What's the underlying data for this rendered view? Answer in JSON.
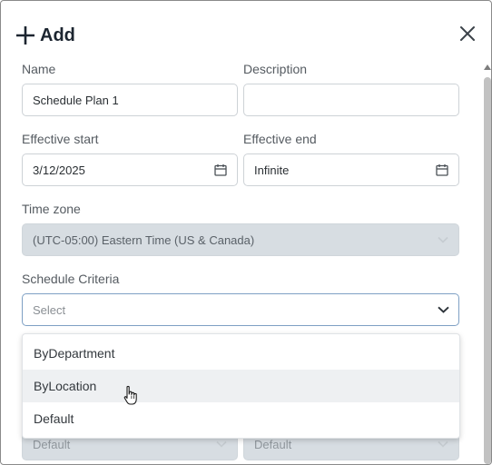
{
  "dialog": {
    "title": "Add",
    "fields": {
      "name": {
        "label": "Name",
        "value": "Schedule Plan 1"
      },
      "description": {
        "label": "Description",
        "value": ""
      },
      "effective_start": {
        "label": "Effective start",
        "value": "3/12/2025"
      },
      "effective_end": {
        "label": "Effective end",
        "value": "Infinite"
      },
      "time_zone": {
        "label": "Time zone",
        "value": "(UTC-05:00) Eastern Time (US & Canada)"
      },
      "schedule_criteria": {
        "label": "Schedule Criteria",
        "placeholder": "Select"
      }
    },
    "dropdown_options": [
      "ByDepartment",
      "ByLocation",
      "Default"
    ],
    "hovered_option": "ByLocation",
    "hidden_fields": {
      "left_value": "Default",
      "right_value": "Default"
    }
  },
  "icons": {
    "add": "plus-icon",
    "close": "close-icon",
    "calendar": "calendar-icon",
    "chevron": "chevron-down-icon",
    "cursor": "hand-pointer-icon"
  }
}
